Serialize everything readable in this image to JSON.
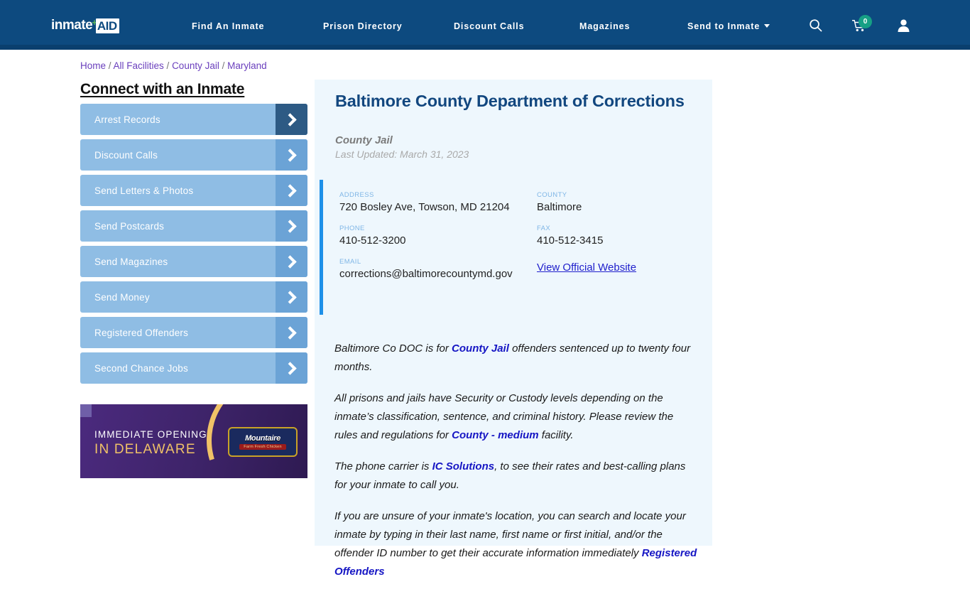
{
  "header": {
    "logo": {
      "word": "inmate",
      "plus": "+",
      "box": "AID"
    },
    "nav": [
      {
        "label": "Find An Inmate",
        "dropdown": false
      },
      {
        "label": "Prison Directory",
        "dropdown": false
      },
      {
        "label": "Discount Calls",
        "dropdown": false
      },
      {
        "label": "Magazines",
        "dropdown": false
      },
      {
        "label": "Send to Inmate",
        "dropdown": true
      }
    ],
    "icons": {
      "search": "search-icon",
      "cart": "cart-icon",
      "cart_count": "0",
      "user": "user-icon"
    },
    "colors": {
      "bar": "#0d4a7f",
      "badge": "#16a085"
    }
  },
  "breadcrumb": {
    "items": [
      "Home",
      "All Facilities",
      "County Jail",
      "Maryland"
    ],
    "separator": "/"
  },
  "sidebar": {
    "title": "Connect with an Inmate",
    "items": [
      {
        "label": "Arrest Records"
      },
      {
        "label": "Discount Calls"
      },
      {
        "label": "Send Letters & Photos"
      },
      {
        "label": "Send Postcards"
      },
      {
        "label": "Send Magazines"
      },
      {
        "label": "Send Money"
      },
      {
        "label": "Registered Offenders"
      },
      {
        "label": "Second Chance Jobs"
      }
    ]
  },
  "ad": {
    "line1": "IMMEDIATE OPENING",
    "line2": "IN DELAWARE",
    "logo_top": "Mountaire",
    "logo_bottom": "Farm Fresh Chicken"
  },
  "facility": {
    "title": "Baltimore County Department of Corrections",
    "type": "County Jail",
    "updated": "Last Updated: March 31, 2023",
    "info": {
      "address_label": "ADDRESS",
      "address_value": "720 Bosley Ave, Towson, MD 21204",
      "county_label": "COUNTY",
      "county_value": "Baltimore",
      "phone_label": "PHONE",
      "phone_value": "410-512-3200",
      "fax_label": "FAX",
      "fax_value": "410-512-3415",
      "email_label": "EMAIL",
      "email_value": "corrections@baltimorecountymd.gov",
      "website_link": "View Official Website"
    },
    "paragraphs": [
      {
        "parts": [
          {
            "t": "Baltimore Co DOC is for ",
            "b": false
          },
          {
            "t": "County Jail",
            "b": true
          },
          {
            "t": " offenders sentenced up to twenty four months.",
            "b": false
          }
        ]
      },
      {
        "parts": [
          {
            "t": "All prisons and jails have Security or Custody levels depending on the inmate’s classification, sentence, and criminal history. Please review the rules and regulations for ",
            "b": false
          },
          {
            "t": "County - medium",
            "b": true
          },
          {
            "t": " facility.",
            "b": false
          }
        ]
      },
      {
        "parts": [
          {
            "t": "The phone carrier is ",
            "b": false
          },
          {
            "t": "IC Solutions",
            "b": true
          },
          {
            "t": ", to see their rates and best-calling plans for your inmate to call you.",
            "b": false
          }
        ]
      },
      {
        "parts": [
          {
            "t": "If you are unsure of your inmate's location, you can search and locate your inmate by typing in their last name, first name or first initial, and/or the offender ID number to get their accurate information immediately ",
            "b": false
          },
          {
            "t": "Registered Offenders",
            "b": true
          }
        ]
      }
    ]
  }
}
